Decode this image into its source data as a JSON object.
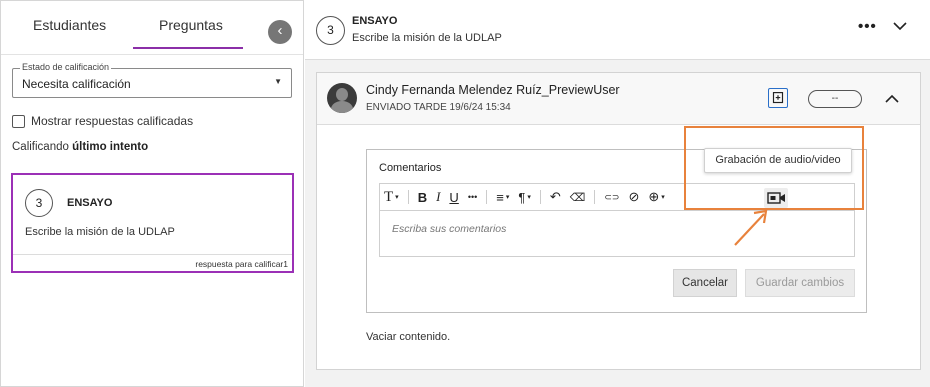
{
  "tabs": {
    "students": "Estudiantes",
    "questions": "Preguntas",
    "back_icon": "chevron-left-icon"
  },
  "status_filter": {
    "legend": "Estado de calificación",
    "value": "Necesita calificación"
  },
  "show_graded": {
    "label": "Mostrar respuestas calificadas",
    "checked": false
  },
  "grading": {
    "prefix": "Calificando",
    "bold": "último intento"
  },
  "question_card": {
    "number": "3",
    "type": "ENSAYO",
    "text": "Escribe la misión de la UDLAP",
    "footer_label": "respuesta para calificar",
    "footer_count": "1"
  },
  "header": {
    "number": "3",
    "type": "ENSAYO",
    "subtitle": "Escribe la misión de la UDLAP",
    "more": "•••"
  },
  "submission": {
    "name": "Cindy Fernanda Melendez Ruíz_PreviewUser",
    "date": "ENVIADO TARDE 19/6/24 15:34",
    "grade": "--"
  },
  "comments": {
    "label": "Comentarios",
    "placeholder": "Escriba sus comentarios",
    "cancel": "Cancelar",
    "save": "Guardar cambios",
    "clear": "Vaciar contenido.",
    "tooltip": "Grabación de audio/video"
  },
  "toolbar": {
    "text_style": "T",
    "bold": "B",
    "italic": "I",
    "underline": "U",
    "more": "•••",
    "align": "≡",
    "paragraph": "¶",
    "undo": "↶",
    "eraser": "⌫",
    "link": "⊂⊃",
    "attach": "⊘",
    "insert": "⊕"
  },
  "colors": {
    "accent_purple": "#9b30b6",
    "highlight_orange": "#e8823c",
    "focus_blue": "#2a6fc9"
  }
}
